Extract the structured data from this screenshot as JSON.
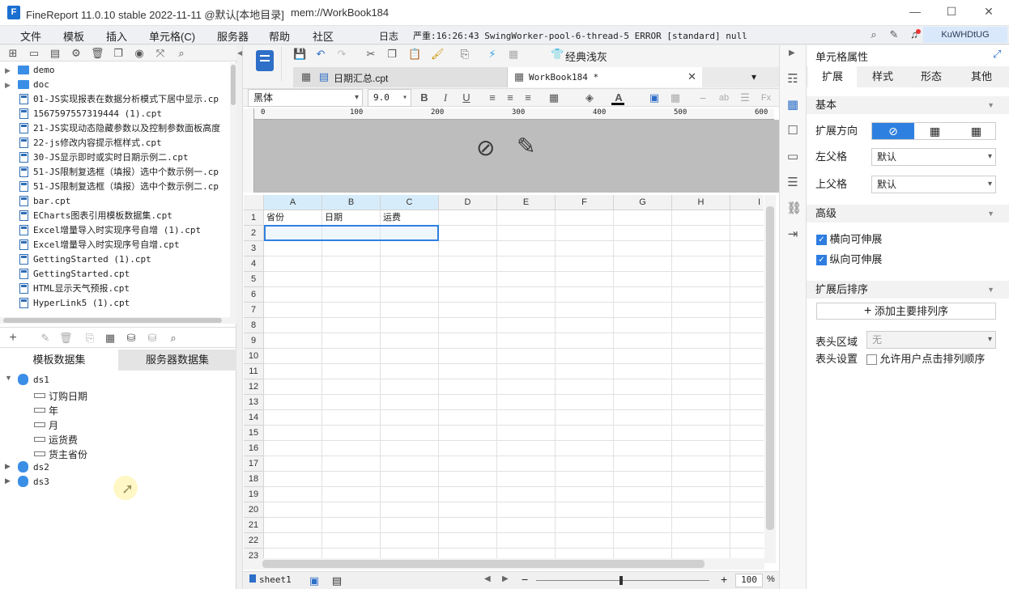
{
  "window": {
    "title": "FineReport 11.0.10 stable 2022-11-11 @默认[本地目录]",
    "path": "mem://WorkBook184",
    "min": "—",
    "max": "☐",
    "close": "✕"
  },
  "menu": [
    "文件",
    "模板",
    "插入",
    "单元格(C)",
    "服务器",
    "帮助",
    "社区"
  ],
  "log": {
    "label": "日志",
    "text": "严重:16:26:43 SwingWorker-pool-6-thread-5 ERROR [standard] null"
  },
  "user": "KuWHDtUG",
  "tree": [
    {
      "type": "folder",
      "label": "demo"
    },
    {
      "type": "folder",
      "label": "doc"
    },
    {
      "type": "file",
      "label": "01-JS实现报表在数据分析模式下居中显示.cp"
    },
    {
      "type": "file",
      "label": "1567597557319444 (1).cpt"
    },
    {
      "type": "file",
      "label": "21-JS实现动态隐藏参数以及控制参数面板高度"
    },
    {
      "type": "file",
      "label": "22-js修改内容提示框样式.cpt"
    },
    {
      "type": "file",
      "label": "30-JS显示即时或实时日期示例二.cpt"
    },
    {
      "type": "file",
      "label": "51-JS限制复选框（填报）选中个数示例一.cp"
    },
    {
      "type": "file",
      "label": "51-JS限制复选框（填报）选中个数示例二.cp"
    },
    {
      "type": "file",
      "label": "bar.cpt"
    },
    {
      "type": "file",
      "label": "ECharts图表引用模板数据集.cpt"
    },
    {
      "type": "file",
      "label": "Excel增量导入时实现序号自增 (1).cpt"
    },
    {
      "type": "file",
      "label": "Excel增量导入时实现序号自增.cpt"
    },
    {
      "type": "file",
      "label": "GettingStarted (1).cpt"
    },
    {
      "type": "file",
      "label": "GettingStarted.cpt"
    },
    {
      "type": "file",
      "label": "HTML显示天气预报.cpt"
    },
    {
      "type": "file",
      "label": "HyperLink5 (1).cpt"
    }
  ],
  "dataset_tabs": [
    "模板数据集",
    "服务器数据集"
  ],
  "datasets": [
    {
      "name": "ds1",
      "fields": [
        "订购日期",
        "年",
        "月",
        "运货费",
        "货主省份"
      ]
    },
    {
      "name": "ds2"
    },
    {
      "name": "ds3"
    }
  ],
  "editor": {
    "classic_gray": "经典浅灰",
    "tabs": [
      "日期汇总.cpt",
      "WorkBook184 *"
    ],
    "font": "黑体",
    "size": "9.0",
    "ruler": [
      "0",
      "100",
      "200",
      "300",
      "400",
      "500",
      "600"
    ],
    "columns": [
      "A",
      "B",
      "C",
      "D",
      "E",
      "F",
      "G",
      "H",
      "I"
    ],
    "rows": [
      "1",
      "2",
      "3",
      "4",
      "5",
      "6",
      "7",
      "8",
      "9",
      "10",
      "11",
      "12",
      "13",
      "14",
      "15",
      "16",
      "17",
      "18",
      "19",
      "20",
      "21",
      "22",
      "23"
    ],
    "cells": {
      "A1": "省份",
      "B1": "日期",
      "C1": "运费"
    },
    "sheet": "sheet1",
    "zoom": "100",
    "percent": "%"
  },
  "props": {
    "title": "单元格属性",
    "tabs": [
      "扩展",
      "样式",
      "形态",
      "其他"
    ],
    "basic": "基本",
    "direction_label": "扩展方向",
    "left_parent_label": "左父格",
    "left_parent_value": "默认",
    "up_parent_label": "上父格",
    "up_parent_value": "默认",
    "advanced": "高级",
    "h_expand": "横向可伸展",
    "v_expand": "纵向可伸展",
    "after_sort": "扩展后排序",
    "add_sort": "添加主要排列序",
    "header_area_label": "表头区域",
    "header_area_value": "无",
    "header_setting_label": "表头设置",
    "allow_sort": "允许用户点击排列顺序"
  }
}
